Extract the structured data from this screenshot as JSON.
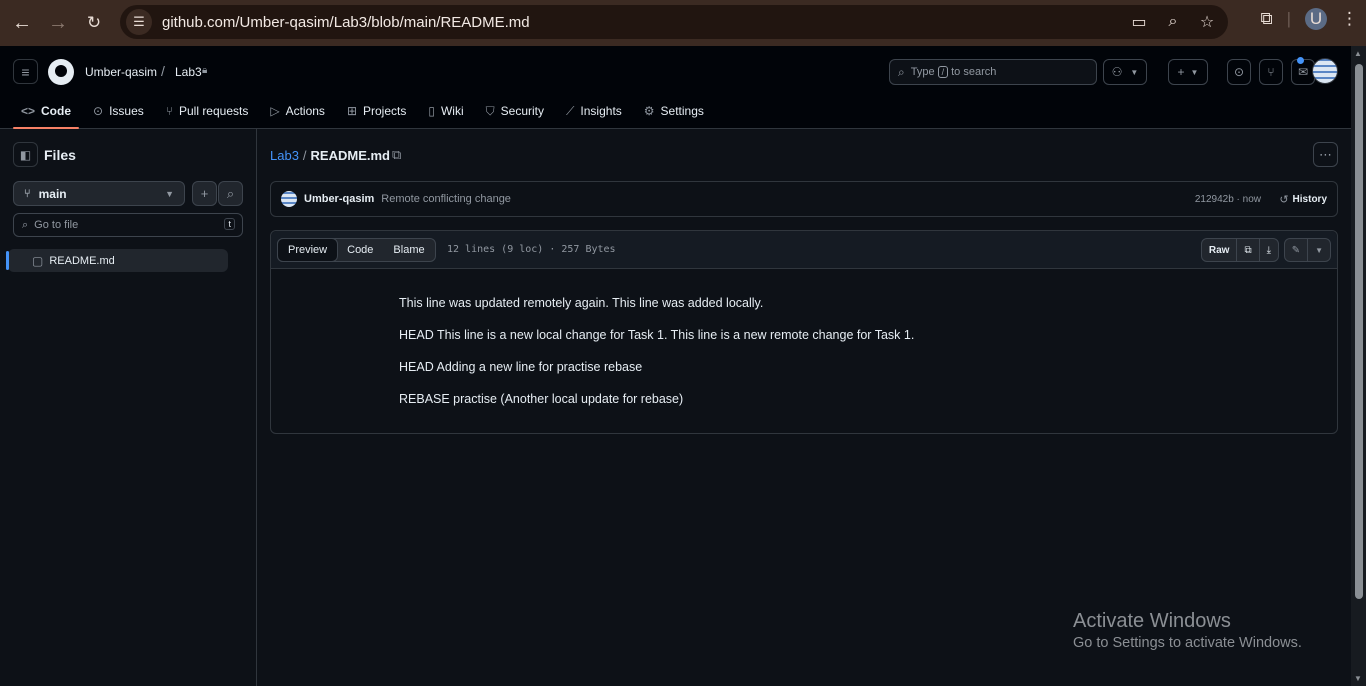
{
  "browser": {
    "url": "github.com/Umber-qasim/Lab3/blob/main/README.md",
    "profile_initial": "U"
  },
  "header": {
    "owner": "Umber-qasim",
    "separator": "/",
    "repo": "Lab3",
    "search": {
      "before": "Type",
      "key": "/",
      "after": "to search"
    }
  },
  "tabs": [
    {
      "label": "Code",
      "icon": "code-icon"
    },
    {
      "label": "Issues",
      "icon": "issue-icon"
    },
    {
      "label": "Pull requests",
      "icon": "pull-request-icon"
    },
    {
      "label": "Actions",
      "icon": "play-icon"
    },
    {
      "label": "Projects",
      "icon": "table-icon"
    },
    {
      "label": "Wiki",
      "icon": "book-icon"
    },
    {
      "label": "Security",
      "icon": "shield-icon"
    },
    {
      "label": "Insights",
      "icon": "graph-icon"
    },
    {
      "label": "Settings",
      "icon": "gear-icon"
    }
  ],
  "sidebar": {
    "title": "Files",
    "branch": "main",
    "goto_placeholder": "Go to file",
    "goto_key": "t",
    "files": [
      "README.md"
    ]
  },
  "breadcrumb": {
    "repo": "Lab3",
    "sep": "/",
    "file": "README.md"
  },
  "commit": {
    "author": "Umber-qasim",
    "message": "Remote conflicting change",
    "meta": "212942b · now",
    "history_label": "History"
  },
  "file": {
    "view_tabs": [
      "Preview",
      "Code",
      "Blame"
    ],
    "info": "12 lines (9 loc) · 257 Bytes",
    "raw_label": "Raw",
    "lines": [
      "This line was updated remotely again. This line was added locally.",
      "HEAD This line is a new local change for Task 1. This line is a new remote change for Task 1.",
      "HEAD Adding a new line for practise rebase",
      "REBASE practise (Another local update for rebase)"
    ]
  },
  "watermark": {
    "title": "Activate Windows",
    "subtitle": "Go to Settings to activate Windows."
  },
  "colors": {
    "accent_underline": "#f78166",
    "link": "#4493f8",
    "browser_frame": "#3b2a22"
  }
}
